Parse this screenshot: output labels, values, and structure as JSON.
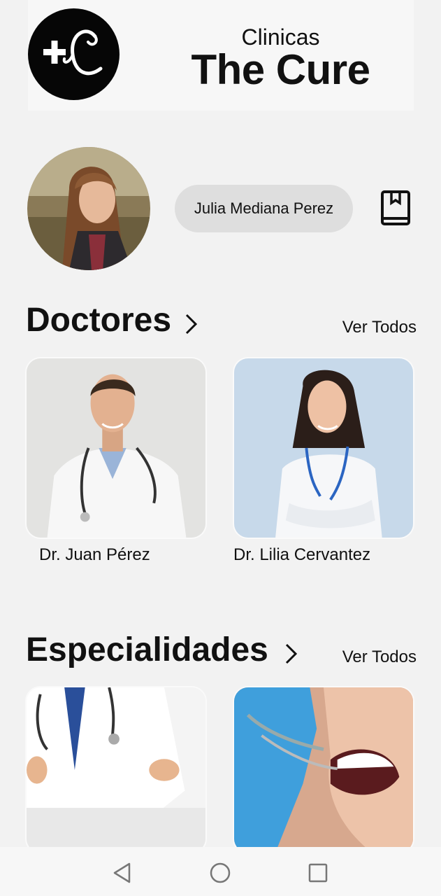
{
  "brand": {
    "subtitle": "Clinicas",
    "title": "The Cure"
  },
  "user": {
    "name": "Julia Mediana Perez"
  },
  "doctors": {
    "title": "Doctores",
    "view_all": "Ver Todos",
    "items": [
      {
        "name": "Dr. Juan Pérez"
      },
      {
        "name": "Dr. Lilia Cervantez"
      }
    ]
  },
  "specialties": {
    "title": "Especialidades",
    "view_all": "Ver Todos"
  },
  "icons": {
    "logo": "plus-cursive-c-logo",
    "book": "bookmark-book-icon",
    "chevron": "chevron-right-icon",
    "nav": [
      "back-triangle-icon",
      "home-circle-icon",
      "recents-square-icon"
    ]
  }
}
